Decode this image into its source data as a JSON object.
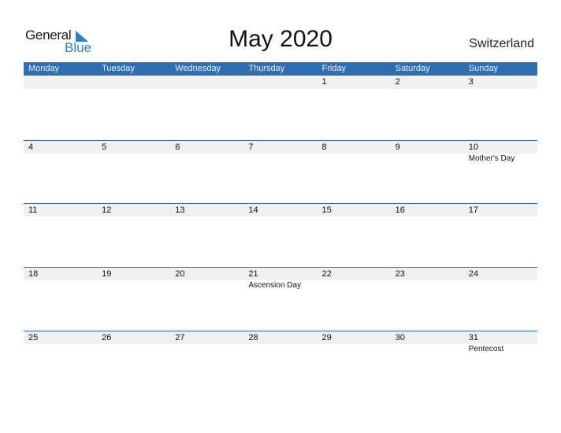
{
  "logo": {
    "general": "General",
    "blue": "Blue"
  },
  "title": "May 2020",
  "country": "Switzerland",
  "weekdays": [
    "Monday",
    "Tuesday",
    "Wednesday",
    "Thursday",
    "Friday",
    "Saturday",
    "Sunday"
  ],
  "weeks": [
    [
      {
        "d": "",
        "e": ""
      },
      {
        "d": "",
        "e": ""
      },
      {
        "d": "",
        "e": ""
      },
      {
        "d": "",
        "e": ""
      },
      {
        "d": "1",
        "e": ""
      },
      {
        "d": "2",
        "e": ""
      },
      {
        "d": "3",
        "e": ""
      }
    ],
    [
      {
        "d": "4",
        "e": ""
      },
      {
        "d": "5",
        "e": ""
      },
      {
        "d": "6",
        "e": ""
      },
      {
        "d": "7",
        "e": ""
      },
      {
        "d": "8",
        "e": ""
      },
      {
        "d": "9",
        "e": ""
      },
      {
        "d": "10",
        "e": "Mother's Day"
      }
    ],
    [
      {
        "d": "11",
        "e": ""
      },
      {
        "d": "12",
        "e": ""
      },
      {
        "d": "13",
        "e": ""
      },
      {
        "d": "14",
        "e": ""
      },
      {
        "d": "15",
        "e": ""
      },
      {
        "d": "16",
        "e": ""
      },
      {
        "d": "17",
        "e": ""
      }
    ],
    [
      {
        "d": "18",
        "e": ""
      },
      {
        "d": "19",
        "e": ""
      },
      {
        "d": "20",
        "e": ""
      },
      {
        "d": "21",
        "e": "Ascension Day"
      },
      {
        "d": "22",
        "e": ""
      },
      {
        "d": "23",
        "e": ""
      },
      {
        "d": "24",
        "e": ""
      }
    ],
    [
      {
        "d": "25",
        "e": ""
      },
      {
        "d": "26",
        "e": ""
      },
      {
        "d": "27",
        "e": ""
      },
      {
        "d": "28",
        "e": ""
      },
      {
        "d": "29",
        "e": ""
      },
      {
        "d": "30",
        "e": ""
      },
      {
        "d": "31",
        "e": "Pentecost"
      }
    ]
  ]
}
